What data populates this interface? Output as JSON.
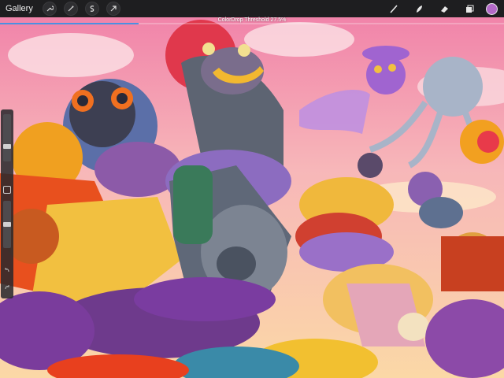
{
  "topbar": {
    "gallery_label": "Gallery",
    "left_tools": [
      "wrench-icon",
      "magic-wand-icon",
      "selection-icon",
      "transform-arrow-icon"
    ],
    "right_tools": [
      "brush-icon",
      "smudge-icon",
      "eraser-icon",
      "layers-icon"
    ],
    "current_color": "#b46ac8"
  },
  "status": {
    "text": "ColorDrop Threshold 27.5%",
    "threshold_fraction": 0.275,
    "accent": "#4a90e2"
  },
  "sidebar": {
    "brush_size_level": 0.3,
    "opacity_level": 0.5
  }
}
